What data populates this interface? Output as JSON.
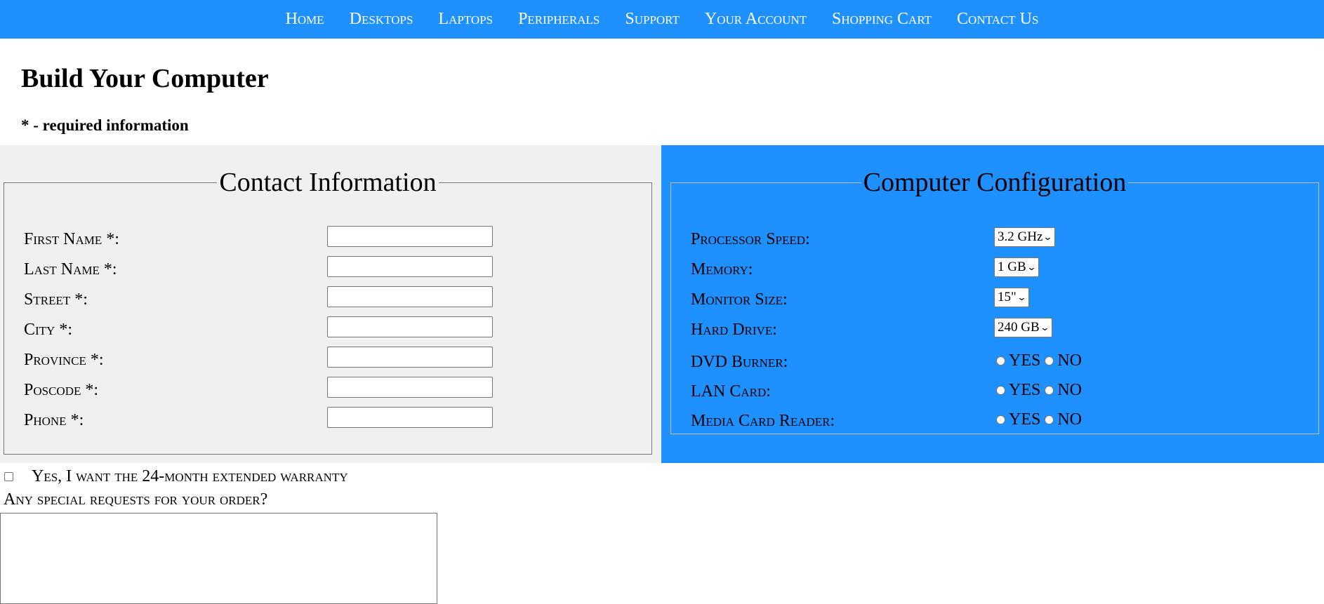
{
  "nav": [
    "Home",
    "Desktops",
    "Laptops",
    "Peripherals",
    "Support",
    "Your Account",
    "Shopping Cart",
    "Contact Us"
  ],
  "page": {
    "title": "Build Your Computer",
    "required_note": "* - required information"
  },
  "contact": {
    "legend": "Contact Information",
    "fields": [
      {
        "label": "First Name *:",
        "value": ""
      },
      {
        "label": "Last Name *:",
        "value": ""
      },
      {
        "label": "Street *:",
        "value": ""
      },
      {
        "label": "City *:",
        "value": ""
      },
      {
        "label": "Province *:",
        "value": ""
      },
      {
        "label": "Poscode *:",
        "value": ""
      },
      {
        "label": "Phone *:",
        "value": ""
      }
    ]
  },
  "config": {
    "legend": "Computer Configuration",
    "selects": [
      {
        "label": "Processor Speed:",
        "value": "3.2 GHz"
      },
      {
        "label": "Memory:",
        "value": "1 GB"
      },
      {
        "label": "Monitor Size:",
        "value": "15\""
      },
      {
        "label": "Hard Drive:",
        "value": "240 GB"
      }
    ],
    "radios": [
      {
        "label": "DVD Burner:",
        "yes": "YES",
        "no": "NO"
      },
      {
        "label": "LAN Card:",
        "yes": "YES",
        "no": "NO"
      },
      {
        "label": "Media Card Reader:",
        "yes": "YES",
        "no": "NO"
      }
    ]
  },
  "warranty": {
    "label": "Yes, I want the 24-month extended warranty",
    "checked": false
  },
  "special_requests": {
    "label": "Any special requests for your order?",
    "value": ""
  },
  "colors": {
    "accent": "#1e90ff",
    "panel_gray": "#f0f0f0"
  }
}
